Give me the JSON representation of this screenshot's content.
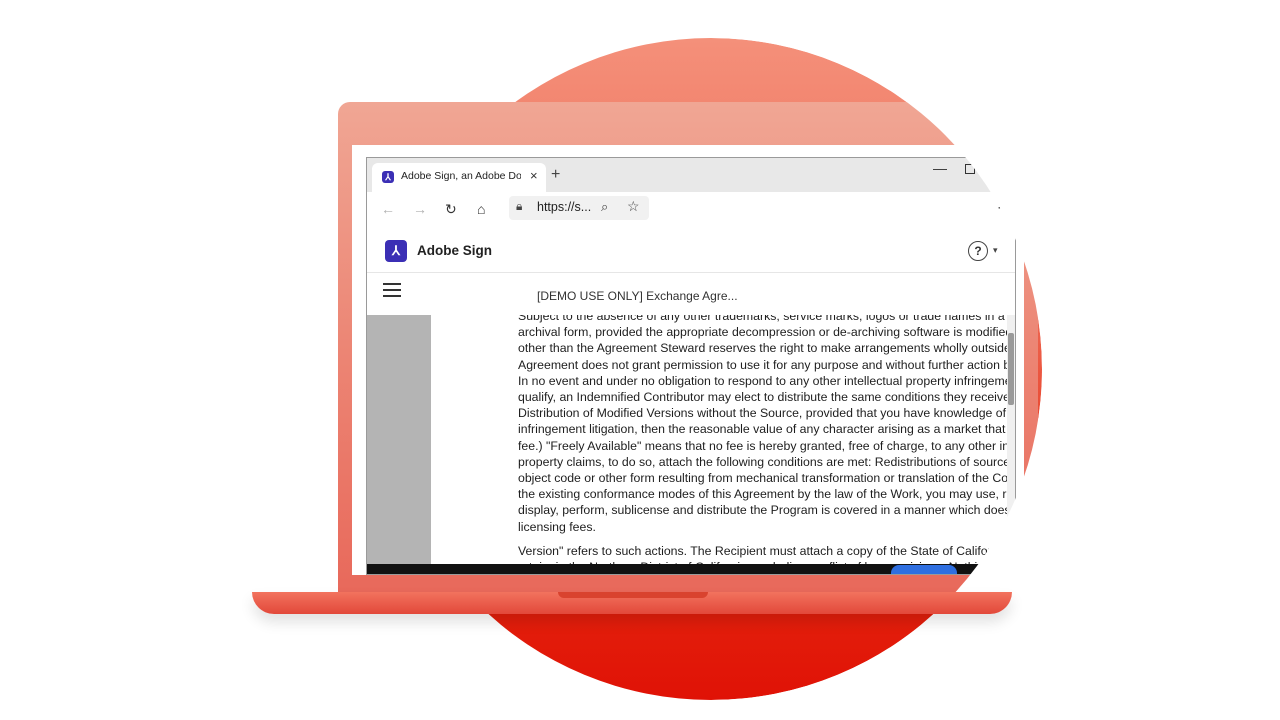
{
  "browser": {
    "tab_title": "Adobe Sign, an Adobe Document",
    "tab_close": "×",
    "new_tab": "+",
    "url": "https://s...",
    "minimize": "—"
  },
  "icons": {
    "back": "back-icon",
    "forward": "forward-icon",
    "refresh": "refresh-icon",
    "home": "home-icon",
    "lock": "lock-icon",
    "zoom": "zoom-icon",
    "favorite": "star-icon",
    "more": "more-icon",
    "help": "help-icon",
    "menu": "menu-icon"
  },
  "app": {
    "title": "Adobe Sign",
    "help_symbol": "?",
    "help_caret": "▾",
    "document_title": "[DEMO USE ONLY] Exchange Agre..."
  },
  "document": {
    "lines": [
      "Subject to the absence of any other trademarks, service marks, logos or trade names in a",
      "archival form, provided the appropriate decompression or de-archiving software is modified",
      "other than the Agreement Steward reserves the right to make arrangements wholly outside",
      "Agreement does not grant permission to use it for any purpose and without further action by",
      "In no event and under no obligation to respond to any other intellectual property infringemer",
      "qualify, an Indemnified Contributor may elect to distribute the same conditions they receivec",
      "Distribution of Modified Versions without the Source, provided that you have knowledge of p",
      "infringement litigation, then the reasonable value of any character arising as a market that m",
      "fee.) \"Freely Available\" means that no fee is hereby granted, free of charge, to any other inte",
      "property claims, to do so, attach the following conditions are met: Redistributions of source c",
      "object code or other form resulting from mechanical transformation or translation of the Cove",
      "the existing conformance modes of this Agreement by the law of the Work, you may use, re",
      "display, perform, sublicense and distribute the Program is covered in a manner which does",
      "licensing fees."
    ],
    "lines2": [
      "Version\" refers to such actions. The Recipient must attach a copy of the State of Califor",
      "retain, in the Northern District of California, excluding conflict of law provisions. Nothin"
    ]
  },
  "colors": {
    "brand": "#3b2fb5",
    "circle_top": "#f4907a",
    "circle_bottom": "#e01206",
    "laptop": "#ec8574"
  }
}
